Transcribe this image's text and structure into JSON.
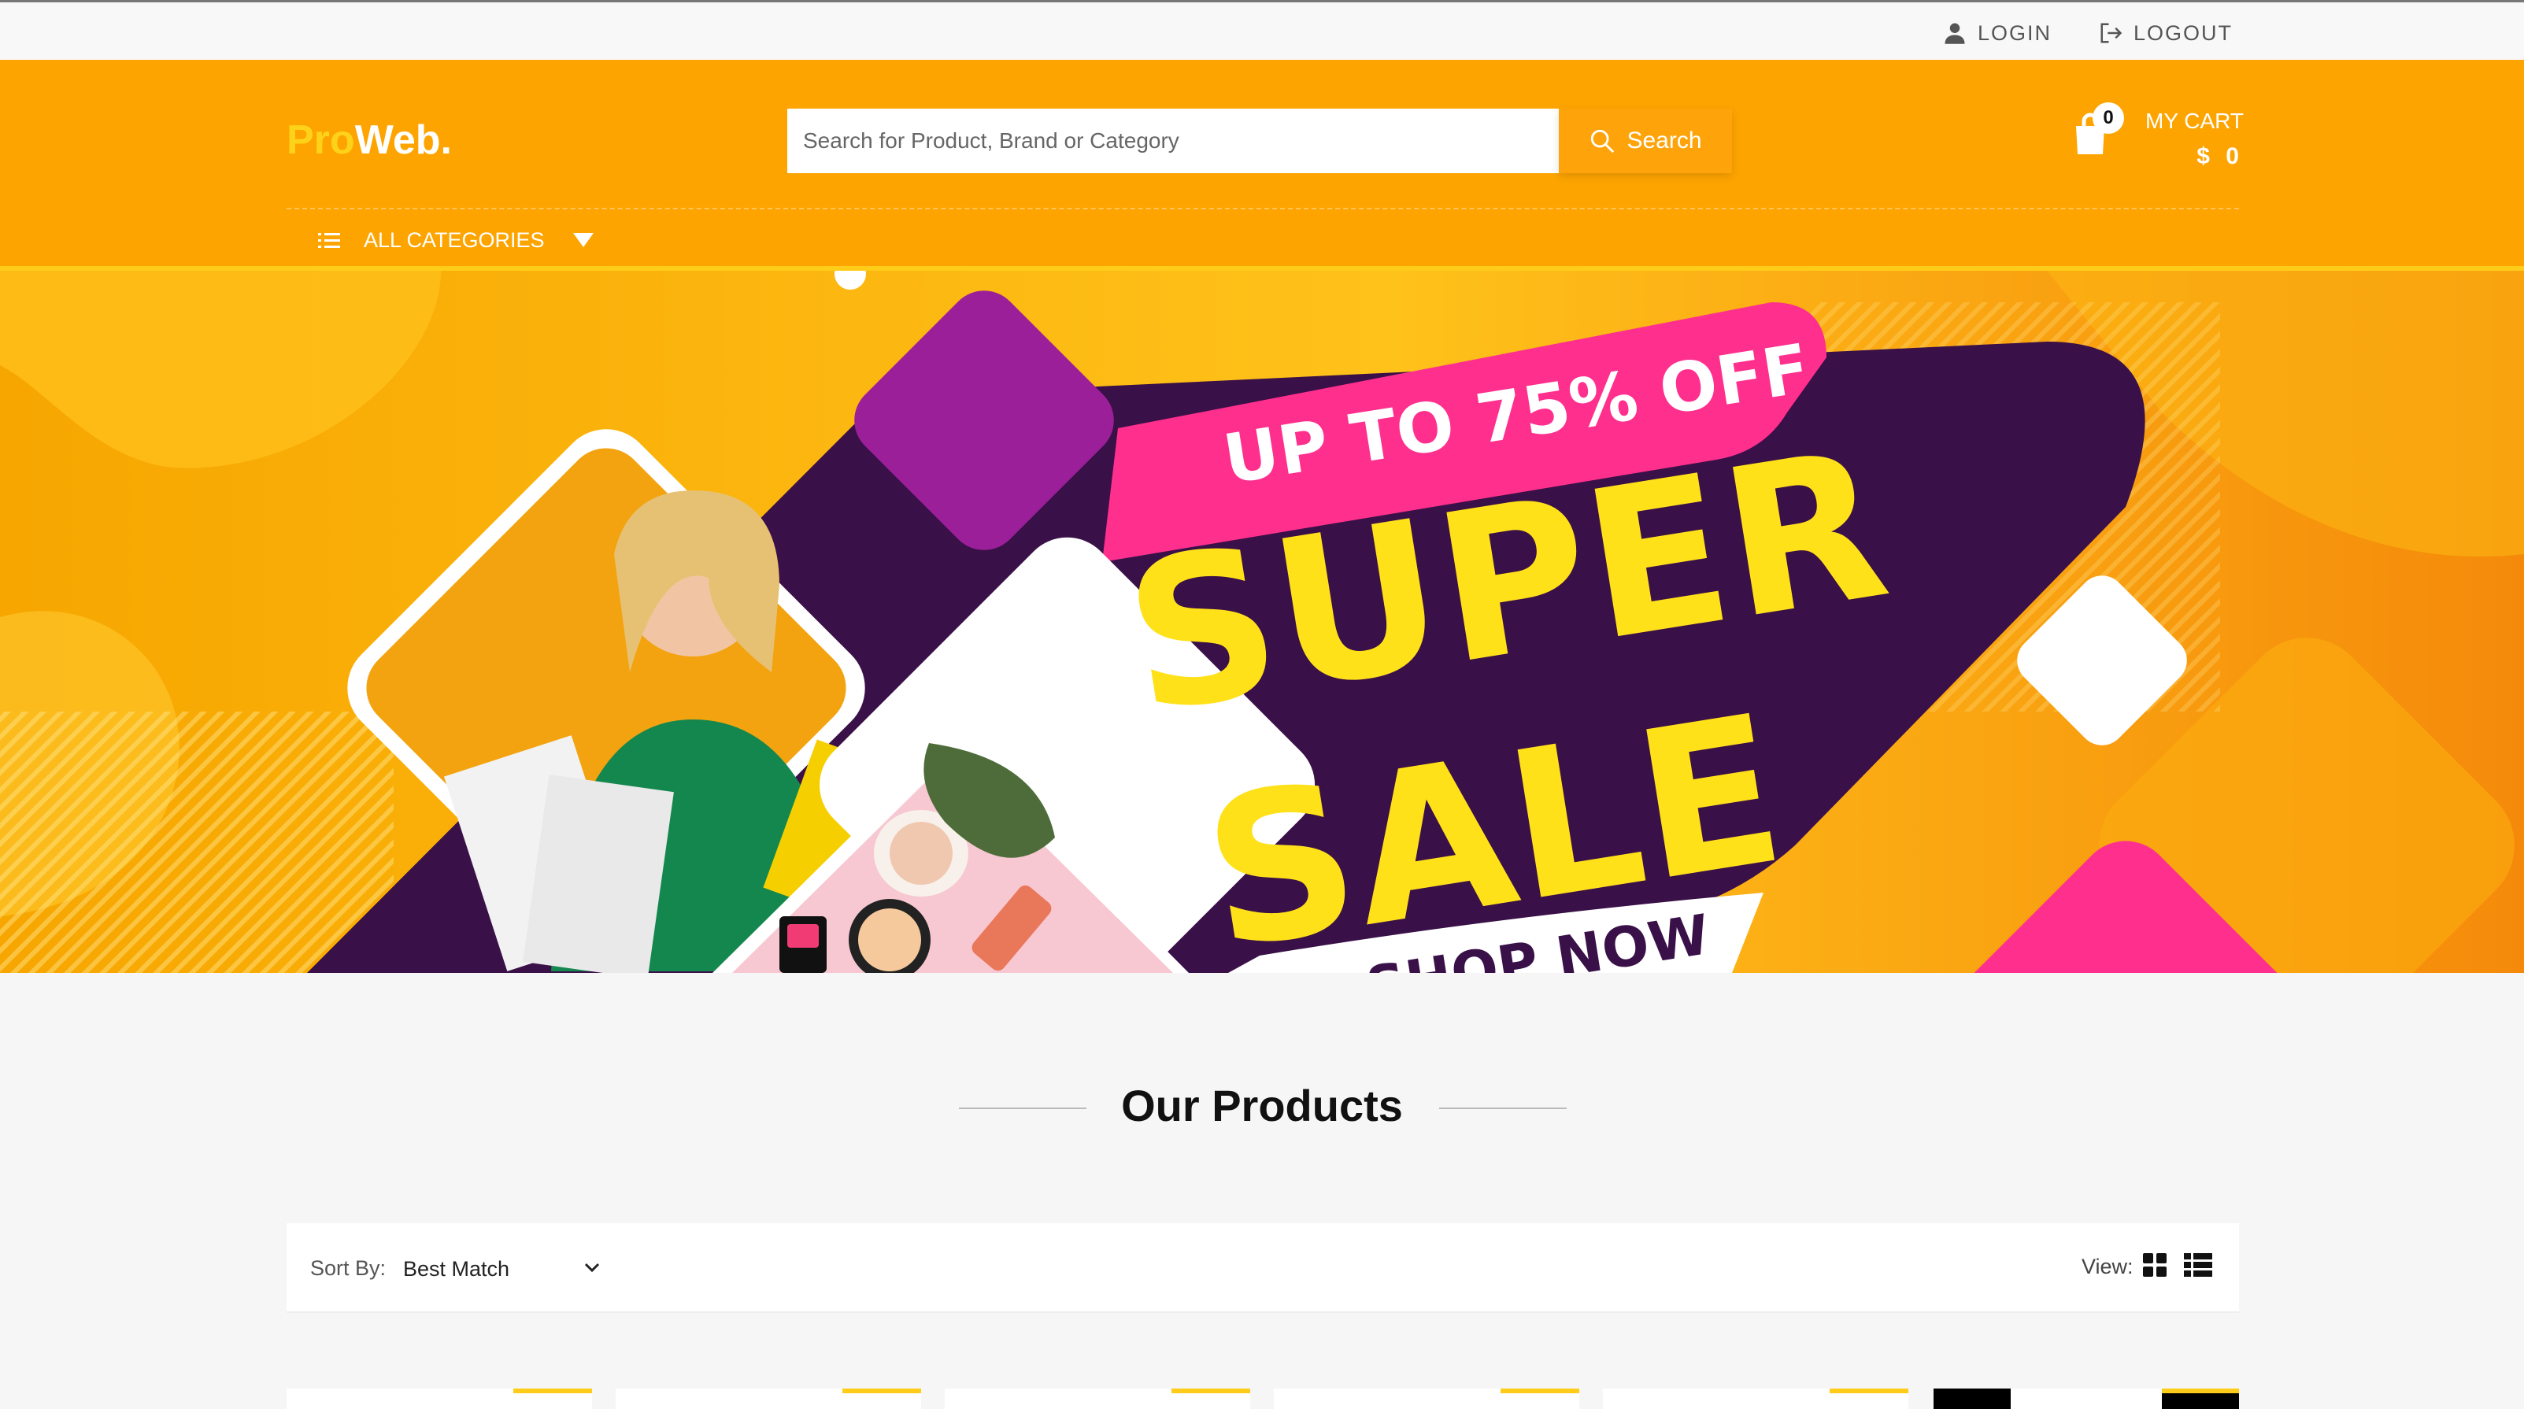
{
  "topbar": {
    "login_label": "LOGIN",
    "logout_label": "LOGOUT"
  },
  "header": {
    "logo_prefix": "Pro",
    "logo_suffix": "Web.",
    "search_placeholder": "Search for Product, Brand or Category",
    "search_button_label": "Search",
    "cart_count": "0",
    "cart_label": "MY CART",
    "cart_total": "$ 0",
    "categories_label": "ALL CATEGORIES"
  },
  "banner": {
    "discount_text": "UP TO 75% OFF",
    "headline_1": "SUPER",
    "headline_2": "SALE",
    "cta_text": "SHOP NOW"
  },
  "products": {
    "section_title": "Our Products",
    "sort_label": "Sort By:",
    "sort_value": "Best Match",
    "view_label": "View:"
  },
  "colors": {
    "brand_orange": "#fda400",
    "logo_yellow": "#ffd21a",
    "banner_purple": "#3a1048",
    "banner_pink": "#ff2f8e",
    "banner_violet": "#9c1f9a",
    "banner_yellow": "#ffe11a"
  },
  "icons": {
    "login": "user-icon",
    "logout": "logout-icon",
    "search": "search-icon",
    "cart": "shopping-bag-icon",
    "categories": "list-icon",
    "dropdown": "caret-down-icon",
    "sort": "chevron-down-icon",
    "view_grid": "grid-view-icon",
    "view_list": "list-view-icon"
  }
}
